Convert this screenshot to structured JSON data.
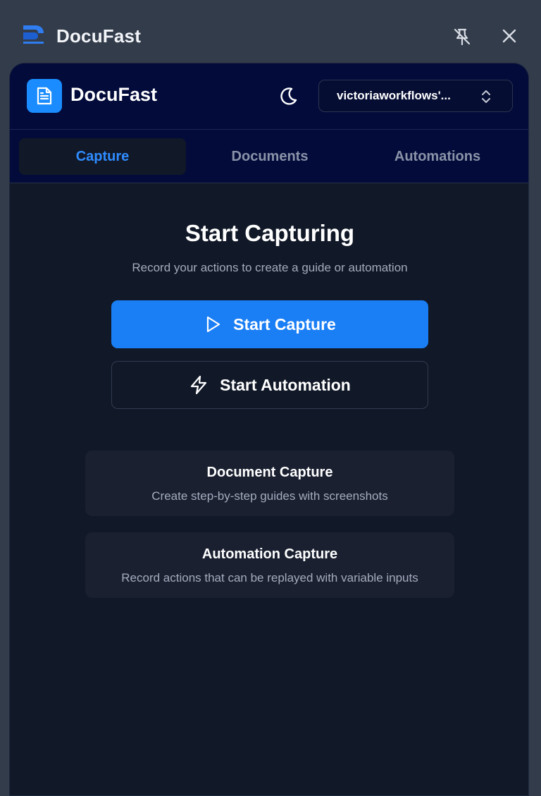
{
  "titlebar": {
    "title": "DocuFast",
    "icons": {
      "logo": "docufast-logo",
      "pin": "unpin-icon",
      "close": "close-icon"
    }
  },
  "header": {
    "app_name": "DocuFast",
    "app_icon": "document-icon",
    "theme_toggle_icon": "moon-icon",
    "workspace": {
      "value": "victoriaworkflows'...",
      "icon": "chevron-up-down-icon"
    }
  },
  "tabs": [
    {
      "label": "Capture",
      "active": true
    },
    {
      "label": "Documents",
      "active": false
    },
    {
      "label": "Automations",
      "active": false
    }
  ],
  "main": {
    "title": "Start Capturing",
    "subtitle": "Record your actions to create a guide or automation",
    "start_capture": {
      "label": "Start Capture",
      "icon": "play-icon"
    },
    "start_automation": {
      "label": "Start Automation",
      "icon": "lightning-icon"
    },
    "cards": [
      {
        "title": "Document Capture",
        "description": "Create step-by-step guides with screenshots"
      },
      {
        "title": "Automation Capture",
        "description": "Record actions that can be replayed with variable inputs"
      }
    ]
  },
  "colors": {
    "window_bg": "#333c4b",
    "panel_bg": "#111827",
    "header_bg": "#030b3a",
    "accent": "#1a7ef5",
    "active_tab_text": "#2f8cff",
    "muted_text": "#a4acbd"
  }
}
